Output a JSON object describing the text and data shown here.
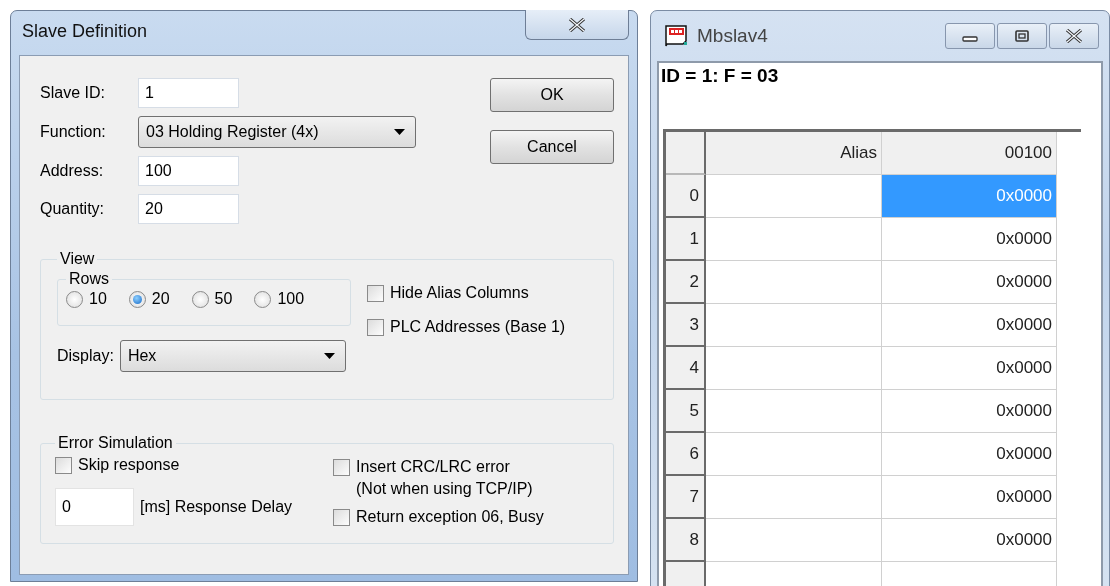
{
  "dialog": {
    "title": "Slave Definition",
    "fields": [
      {
        "label": "Slave ID:",
        "kind": "text",
        "value": "1"
      },
      {
        "label": "Function:",
        "kind": "dropdown",
        "value": "03 Holding Register (4x)"
      },
      {
        "label": "Address:",
        "kind": "text",
        "value": "100"
      },
      {
        "label": "Quantity:",
        "kind": "text",
        "value": "20"
      }
    ],
    "buttons": [
      "OK",
      "Cancel"
    ],
    "view": {
      "title": "View",
      "rows_group": {
        "title": "Rows",
        "options": [
          {
            "label": "10",
            "selected": false
          },
          {
            "label": "20",
            "selected": true
          },
          {
            "label": "50",
            "selected": false
          },
          {
            "label": "100",
            "selected": false
          }
        ]
      },
      "checkboxes": [
        {
          "label": "Hide Alias Columns",
          "checked": false
        },
        {
          "label": "PLC Addresses (Base 1)",
          "checked": false
        }
      ],
      "display": {
        "label": "Display:",
        "value": "Hex"
      }
    },
    "error_simulation": {
      "title": "Error Simulation",
      "skip_response": {
        "label": "Skip response",
        "checked": false
      },
      "delay": {
        "value": "0",
        "label": "[ms] Response Delay"
      },
      "checkboxes": [
        {
          "label": "Insert CRC/LRC error",
          "note": "(Not when using TCP/IP)",
          "checked": false
        },
        {
          "label": "Return exception 06, Busy",
          "checked": false
        }
      ]
    }
  },
  "slave_window": {
    "title": "Mbslav4",
    "status": "ID = 1: F = 03",
    "table": {
      "columns": [
        "Alias",
        "00100"
      ],
      "rows": [
        {
          "index": "0",
          "value": "0x0000",
          "selected": true
        },
        {
          "index": "1",
          "value": "0x0000",
          "selected": false
        },
        {
          "index": "2",
          "value": "0x0000",
          "selected": false
        },
        {
          "index": "3",
          "value": "0x0000",
          "selected": false
        },
        {
          "index": "4",
          "value": "0x0000",
          "selected": false
        },
        {
          "index": "5",
          "value": "0x0000",
          "selected": false
        },
        {
          "index": "6",
          "value": "0x0000",
          "selected": false
        },
        {
          "index": "7",
          "value": "0x0000",
          "selected": false
        },
        {
          "index": "8",
          "value": "0x0000",
          "selected": false
        }
      ]
    }
  }
}
